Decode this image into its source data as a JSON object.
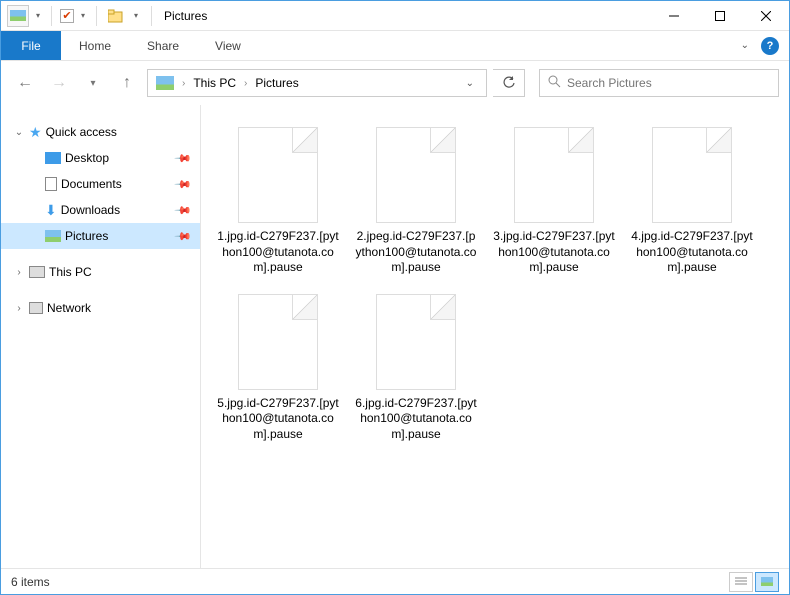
{
  "window": {
    "title": "Pictures"
  },
  "ribbon": {
    "file": "File",
    "tabs": [
      "Home",
      "Share",
      "View"
    ]
  },
  "breadcrumb": {
    "root": "This PC",
    "current": "Pictures"
  },
  "search": {
    "placeholder": "Search Pictures"
  },
  "nav": {
    "quick_access": "Quick access",
    "items": [
      {
        "label": "Desktop",
        "pinned": true
      },
      {
        "label": "Documents",
        "pinned": true
      },
      {
        "label": "Downloads",
        "pinned": true
      },
      {
        "label": "Pictures",
        "pinned": true,
        "selected": true
      }
    ],
    "this_pc": "This PC",
    "network": "Network"
  },
  "files": [
    {
      "name": "1.jpg.id-C279F237.[python100@tutanota.com].pause"
    },
    {
      "name": "2.jpeg.id-C279F237.[python100@tutanota.com].pause"
    },
    {
      "name": "3.jpg.id-C279F237.[python100@tutanota.com].pause"
    },
    {
      "name": "4.jpg.id-C279F237.[python100@tutanota.com].pause"
    },
    {
      "name": "5.jpg.id-C279F237.[python100@tutanota.com].pause"
    },
    {
      "name": "6.jpg.id-C279F237.[python100@tutanota.com].pause"
    }
  ],
  "status": {
    "count_label": "6 items"
  }
}
